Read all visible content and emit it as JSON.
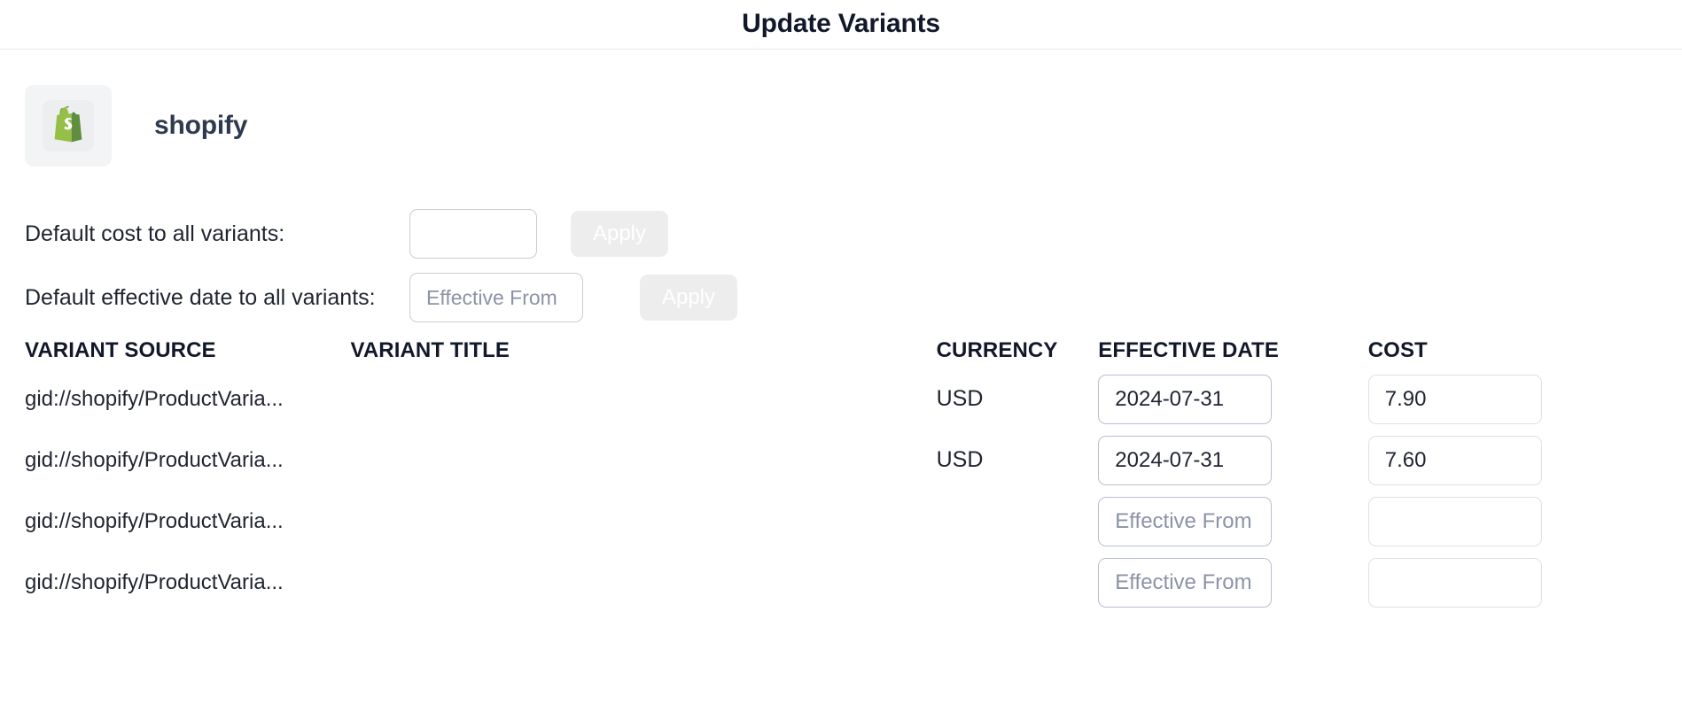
{
  "header": {
    "title": "Update Variants"
  },
  "provider": {
    "name": "shopify",
    "logo_icon": "shopify-bag-icon",
    "logo_color": "#95bf47"
  },
  "defaults": {
    "cost": {
      "label": "Default cost to all variants:",
      "input_value": "",
      "input_placeholder": "",
      "apply_label": "Apply"
    },
    "date": {
      "label": "Default effective date to all variants:",
      "input_value": "",
      "input_placeholder": "Effective From",
      "apply_label": "Apply"
    }
  },
  "table": {
    "columns": [
      "VARIANT SOURCE",
      "VARIANT TITLE",
      "CURRENCY",
      "EFFECTIVE DATE",
      "COST"
    ],
    "rows": [
      {
        "source": "gid://shopify/ProductVaria...",
        "title": "",
        "currency": "USD",
        "effective_date": "2024-07-31",
        "effective_date_placeholder": "Effective From",
        "cost": "7.90",
        "cost_placeholder": ""
      },
      {
        "source": "gid://shopify/ProductVaria...",
        "title": "",
        "currency": "USD",
        "effective_date": "2024-07-31",
        "effective_date_placeholder": "Effective From",
        "cost": "7.60",
        "cost_placeholder": ""
      },
      {
        "source": "gid://shopify/ProductVaria...",
        "title": "",
        "currency": "",
        "effective_date": "",
        "effective_date_placeholder": "Effective From",
        "cost": "",
        "cost_placeholder": ""
      },
      {
        "source": "gid://shopify/ProductVaria...",
        "title": "",
        "currency": "",
        "effective_date": "",
        "effective_date_placeholder": "Effective From",
        "cost": "",
        "cost_placeholder": ""
      }
    ]
  },
  "colors": {
    "title_text": "#11182a",
    "body_text": "#1f2430",
    "placeholder_text": "#8b93a7",
    "input_border": "#b9bfce",
    "disabled_button_bg": "#ededee",
    "divider": "#e6e8ec"
  }
}
